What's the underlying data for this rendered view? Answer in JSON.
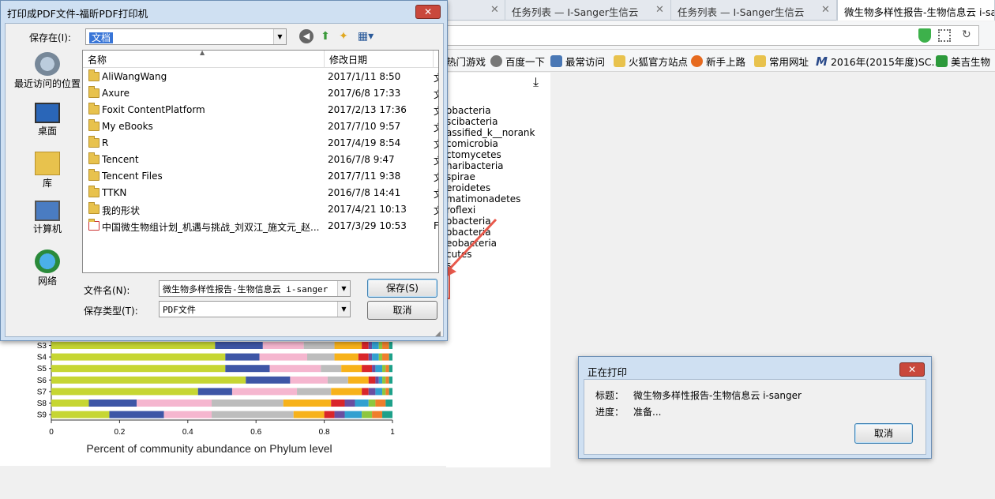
{
  "browser": {
    "tabs": [
      {
        "label": "",
        "active": false
      },
      {
        "label": "任务列表 — I-Sanger生信云",
        "active": false
      },
      {
        "label": "任务列表 — I-Sanger生信云",
        "active": false
      },
      {
        "label": "微生物多样性报告-生物信息云 i-sang",
        "active": true
      }
    ],
    "bookmarks": [
      "热门游戏",
      "百度一下",
      "最常访问",
      "火狐官方站点",
      "新手上路",
      "常用网址",
      "2016年(2015年度)SC...",
      "美吉生物"
    ]
  },
  "page_labels": [
    "obacteria",
    "scibacteria",
    "assified_k__norank",
    "comicrobia",
    "ctomycetes",
    "haribacteria",
    "spirae",
    "eroidetes",
    "matimonadetes",
    "roflexi",
    "obacteria",
    "obacteria",
    "eobacteria",
    "cutes",
    "s"
  ],
  "chart_data": {
    "type": "bar",
    "orientation": "horizontal",
    "stacked": true,
    "categories": [
      "S3",
      "S4",
      "S5",
      "S6",
      "S7",
      "S8",
      "S9"
    ],
    "xlabel": "Percent of community abundance on Phylum level",
    "xticks": [
      "0",
      "0.2",
      "0.4",
      "0.6",
      "0.8",
      "1"
    ],
    "xlim": [
      0,
      1
    ],
    "colors": [
      "#c6d633",
      "#3e56a6",
      "#f5b6cf",
      "#bdbdbd",
      "#f7b21a",
      "#d9262a",
      "#6a4fa0",
      "#32a0d0",
      "#8dc63f",
      "#ef7e2b",
      "#1ea18a"
    ],
    "series_values": [
      [
        0.48,
        0.14,
        0.12,
        0.09,
        0.08,
        0.02,
        0.01,
        0.02,
        0.01,
        0.02,
        0.01
      ],
      [
        0.51,
        0.1,
        0.14,
        0.08,
        0.07,
        0.03,
        0.01,
        0.02,
        0.01,
        0.02,
        0.01
      ],
      [
        0.51,
        0.13,
        0.15,
        0.06,
        0.06,
        0.03,
        0.01,
        0.02,
        0.01,
        0.01,
        0.01
      ],
      [
        0.57,
        0.13,
        0.11,
        0.06,
        0.06,
        0.02,
        0.01,
        0.01,
        0.01,
        0.01,
        0.01
      ],
      [
        0.43,
        0.1,
        0.19,
        0.1,
        0.09,
        0.02,
        0.02,
        0.02,
        0.01,
        0.01,
        0.01
      ],
      [
        0.11,
        0.14,
        0.22,
        0.21,
        0.14,
        0.04,
        0.03,
        0.04,
        0.02,
        0.03,
        0.02
      ],
      [
        0.17,
        0.16,
        0.14,
        0.24,
        0.09,
        0.03,
        0.03,
        0.05,
        0.03,
        0.03,
        0.03
      ]
    ]
  },
  "save_dialog": {
    "title": "打印成PDF文件-福昕PDF打印机",
    "close": "✕",
    "save_in_label": "保存在(I):",
    "save_in_value": "文档",
    "places": [
      "最近访问的位置",
      "桌面",
      "库",
      "计算机",
      "网络"
    ],
    "columns": {
      "name": "名称",
      "date": "修改日期"
    },
    "files": [
      {
        "name": "AliWangWang",
        "date": "2017/1/11 8:50",
        "type": "文"
      },
      {
        "name": "Axure",
        "date": "2017/6/8 17:33",
        "type": "文"
      },
      {
        "name": "Foxit ContentPlatform",
        "date": "2017/2/13 17:36",
        "type": "文"
      },
      {
        "name": "My eBooks",
        "date": "2017/7/10 9:57",
        "type": "文"
      },
      {
        "name": "R",
        "date": "2017/4/19 8:54",
        "type": "文"
      },
      {
        "name": "Tencent",
        "date": "2016/7/8 9:47",
        "type": "文"
      },
      {
        "name": "Tencent Files",
        "date": "2017/7/11 9:38",
        "type": "文"
      },
      {
        "name": "TTKN",
        "date": "2016/7/8 14:41",
        "type": "文"
      },
      {
        "name": "我的形状",
        "date": "2017/4/21 10:13",
        "type": "文"
      },
      {
        "name": "中国微生物组计划_机遇与挑战_刘双江_施文元_赵...",
        "date": "2017/3/29 10:53",
        "type": "F"
      }
    ],
    "filename_label": "文件名(N):",
    "filename_value": "微生物多样性报告-生物信息云 i-sanger",
    "filetype_label": "保存类型(T):",
    "filetype_value": "PDF文件",
    "save_button": "保存(S)",
    "cancel_button": "取消"
  },
  "print_dialog": {
    "title": "正在打印",
    "close": "✕",
    "title_label": "标题：",
    "title_value": "微生物多样性报告-生物信息云 i-sanger",
    "progress_label": "进度：",
    "progress_value": "准备...",
    "cancel_button": "取消"
  }
}
